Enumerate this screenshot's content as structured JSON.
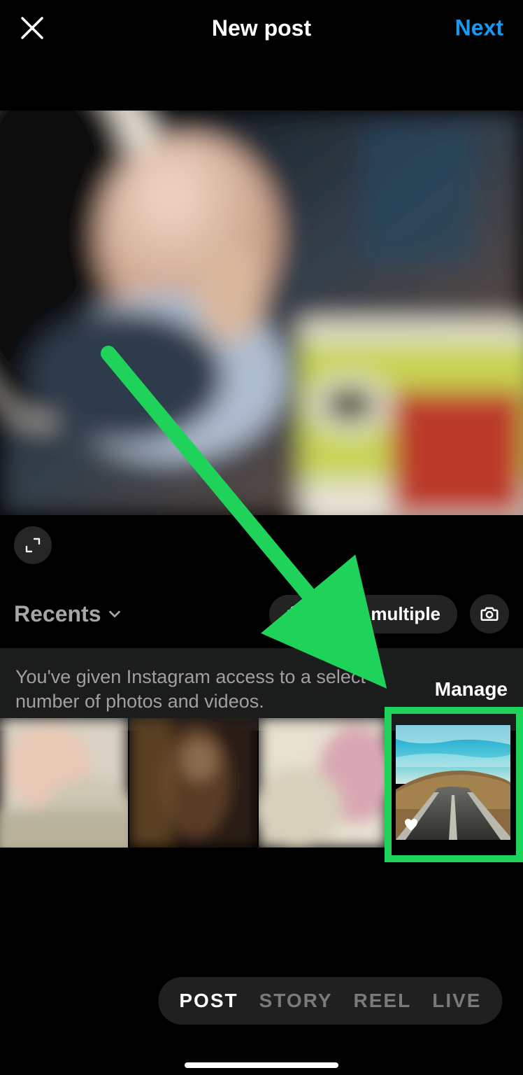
{
  "header": {
    "title": "New post",
    "next_label": "Next",
    "close_icon": "close-icon"
  },
  "album_selector": {
    "label": "Recents",
    "chevron_icon": "chevron-down-icon"
  },
  "select_multiple": {
    "label": "Select multiple",
    "icon": "stack-icon"
  },
  "camera_icon": "camera-icon",
  "expand_icon": "expand-icon",
  "permission_banner": {
    "text": "You've given Instagram access to a select number of photos and videos.",
    "manage_label": "Manage"
  },
  "thumbnails": [
    {
      "name": "thumb-1",
      "favorite": false
    },
    {
      "name": "thumb-2",
      "favorite": false
    },
    {
      "name": "thumb-3",
      "favorite": false
    },
    {
      "name": "thumb-4",
      "favorite": true
    }
  ],
  "modes": [
    {
      "label": "POST",
      "active": true
    },
    {
      "label": "STORY",
      "active": false
    },
    {
      "label": "REEL",
      "active": false
    },
    {
      "label": "LIVE",
      "active": false
    }
  ],
  "annotation": {
    "highlight_target": "thumb-4",
    "arrow_color": "#1fd35a"
  },
  "colors": {
    "accent_blue": "#169bf0",
    "annotation_green": "#1fd35a"
  }
}
